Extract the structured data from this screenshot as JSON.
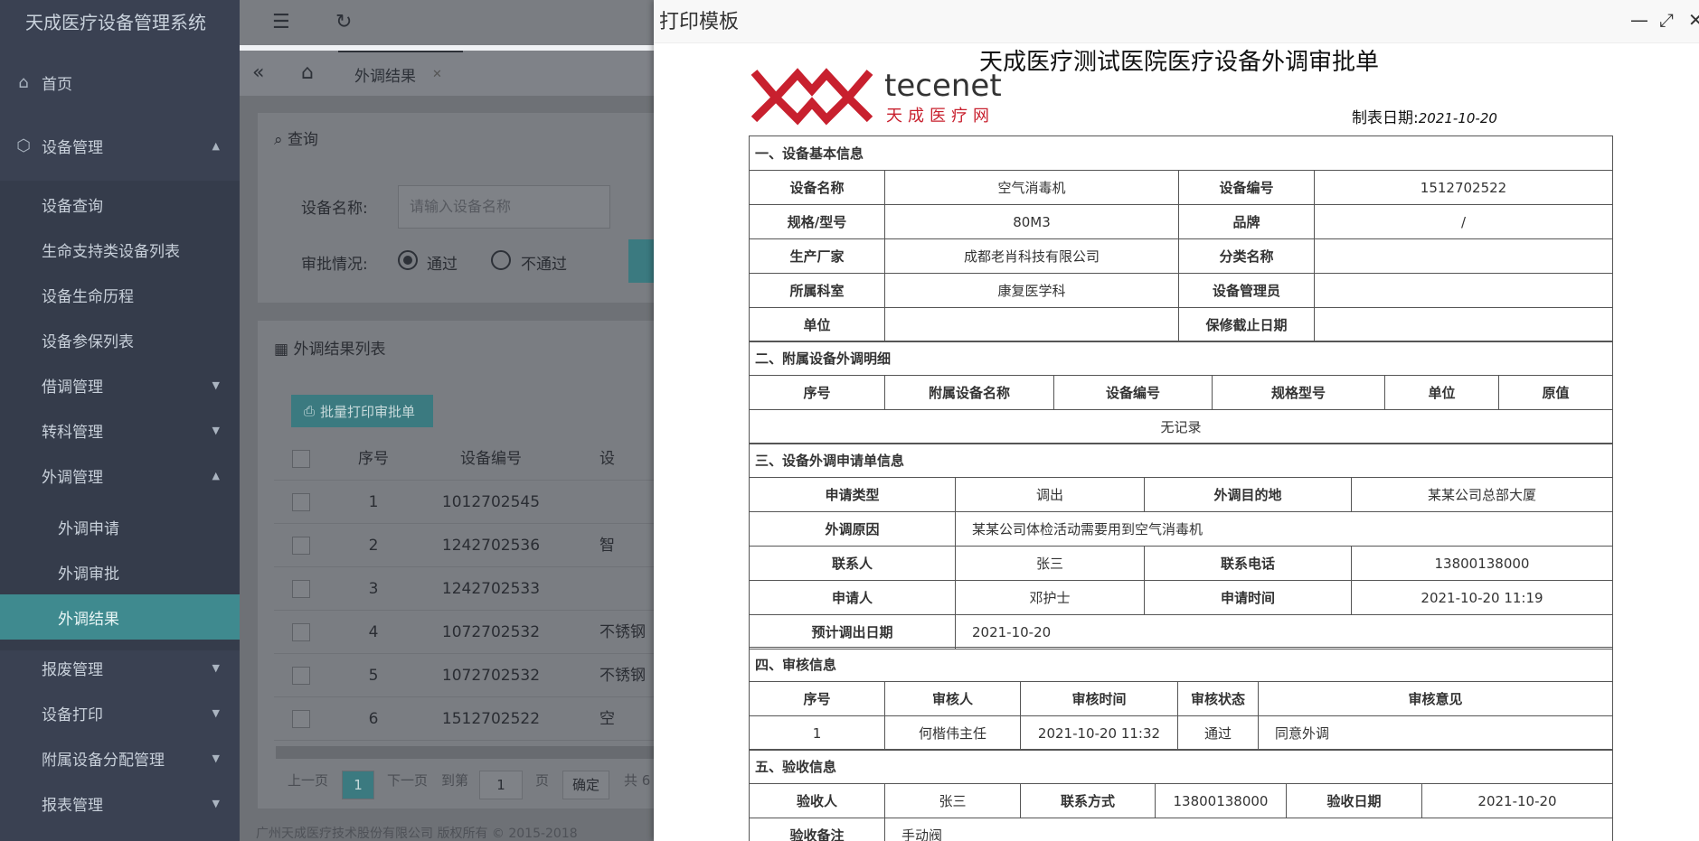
{
  "sidebar": {
    "brand": "天成医疗设备管理系统",
    "home": "首页",
    "device_mgmt": "设备管理",
    "items": [
      "设备查询",
      "生命支持类设备列表",
      "设备生命历程",
      "设备参保列表"
    ],
    "borrow": "借调管理",
    "transfer": "转科管理",
    "external": "外调管理",
    "external_sub": [
      "外调申请",
      "外调审批",
      "外调结果"
    ],
    "scrap": "报废管理",
    "print": "设备打印",
    "accessory": "附属设备分配管理",
    "report": "报表管理"
  },
  "tabs": {
    "current": "外调结果"
  },
  "query": {
    "title": "查询",
    "name_label": "设备名称:",
    "name_placeholder": "请输入设备名称",
    "approve_label": "审批情况:",
    "pass": "通过",
    "fail": "不通过"
  },
  "list": {
    "title": "外调结果列表",
    "batch_print": "批量打印审批单",
    "headers": [
      "序号",
      "设备编号",
      "设"
    ],
    "rows": [
      [
        "1",
        "1012702545",
        ""
      ],
      [
        "2",
        "1242702536",
        "智"
      ],
      [
        "3",
        "1242702533",
        ""
      ],
      [
        "4",
        "1072702532",
        "不锈钢"
      ],
      [
        "5",
        "1072702532",
        "不锈钢"
      ],
      [
        "6",
        "1512702522",
        "空"
      ]
    ]
  },
  "pager": {
    "prev": "上一页",
    "page": "1",
    "next": "下一页",
    "goto": "到第",
    "page_input": "1",
    "page_unit": "页",
    "confirm": "确定",
    "total": "共 6"
  },
  "footer": "广州天成医疗技术股份有限公司 版权所有 © 2015-2018",
  "modal": {
    "title": "打印模板",
    "doc_title": "天成医疗测试医院医疗设备外调审批单",
    "logo_en": "tecenet",
    "logo_cn": "天成医疗网",
    "date_label": "制表日期:",
    "date_value": "2021-10-20",
    "s1": "一、设备基本信息",
    "s1_rows": [
      [
        "设备名称",
        "空气消毒机",
        "设备编号",
        "1512702522"
      ],
      [
        "规格/型号",
        "80M3",
        "品牌",
        "/"
      ],
      [
        "生产厂家",
        "成都老肖科技有限公司",
        "分类名称",
        ""
      ],
      [
        "所属科室",
        "康复医学科",
        "设备管理员",
        ""
      ],
      [
        "单位",
        "",
        "保修截止日期",
        ""
      ]
    ],
    "s2": "二、附属设备外调明细",
    "s2_headers": [
      "序号",
      "附属设备名称",
      "设备编号",
      "规格型号",
      "单位",
      "原值"
    ],
    "s2_empty": "无记录",
    "s3": "三、设备外调申请单信息",
    "s3_type_label": "申请类型",
    "s3_type": "调出",
    "s3_dest_label": "外调目的地",
    "s3_dest": "某某公司总部大厦",
    "s3_reason_label": "外调原因",
    "s3_reason": "某某公司体检活动需要用到空气消毒机",
    "s3_contact_label": "联系人",
    "s3_contact": "张三",
    "s3_phone_label": "联系电话",
    "s3_phone": "13800138000",
    "s3_applicant_label": "申请人",
    "s3_applicant": "邓护士",
    "s3_time_label": "申请时间",
    "s3_time": "2021-10-20 11:19",
    "s3_out_label": "预计调出日期",
    "s3_out": "2021-10-20",
    "s4": "四、审核信息",
    "s4_headers": [
      "序号",
      "审核人",
      "审核时间",
      "审核状态",
      "审核意见"
    ],
    "s4_row": [
      "1",
      "何楷伟主任",
      "2021-10-20 11:32",
      "通过",
      "同意外调"
    ],
    "s5": "五、验收信息",
    "s5_acceptor_label": "验收人",
    "s5_acceptor": "张三",
    "s5_contact_label": "联系方式",
    "s5_contact": "13800138000",
    "s5_date_label": "验收日期",
    "s5_date": "2021-10-20",
    "s5_note_label": "验收备注",
    "s5_note": "手动阀"
  }
}
